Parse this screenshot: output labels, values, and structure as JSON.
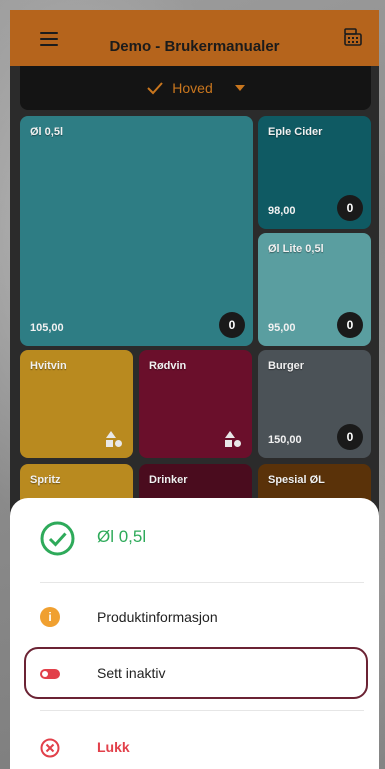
{
  "appbar": {
    "title": "Demo - Brukermanualer",
    "menu_icon": "hamburger-menu-icon",
    "register_icon": "cash-register-icon",
    "color": "#b5641c"
  },
  "subbar": {
    "label": "Hoved",
    "accent": "#c9761e"
  },
  "tiles": [
    {
      "label": "Øl 0,5l",
      "price": "105,00",
      "count": "0",
      "color": "#2e7d84"
    },
    {
      "label": "Eple Cider",
      "price": "98,00",
      "count": "0",
      "color": "#0f5a63"
    },
    {
      "label": "Øl Lite 0,5l",
      "price": "95,00",
      "count": "0",
      "color": "#5a9ea0"
    },
    {
      "label": "Hvitvin",
      "price": "",
      "count": "",
      "color": "#b98a1f"
    },
    {
      "label": "Rødvin",
      "price": "",
      "count": "",
      "color": "#6a0f2b"
    },
    {
      "label": "Burger",
      "price": "150,00",
      "count": "0",
      "color": "#4b5257"
    },
    {
      "label": "Spritz",
      "price": "",
      "count": "",
      "color": "#b98a1f"
    },
    {
      "label": "Drinker",
      "price": "",
      "count": "",
      "color": "#4a0c1e"
    },
    {
      "label": "Spesial ØL",
      "price": "",
      "count": "",
      "color": "#5a3209"
    }
  ],
  "sheet": {
    "title": "Øl 0,5l",
    "title_color": "#2eaa5a",
    "items": [
      {
        "label": "Produktinformasjon",
        "icon": "info-icon"
      },
      {
        "label": "Sett inaktiv",
        "icon": "toggle-icon"
      },
      {
        "label": "Lukk",
        "icon": "close-circle-icon"
      }
    ]
  }
}
